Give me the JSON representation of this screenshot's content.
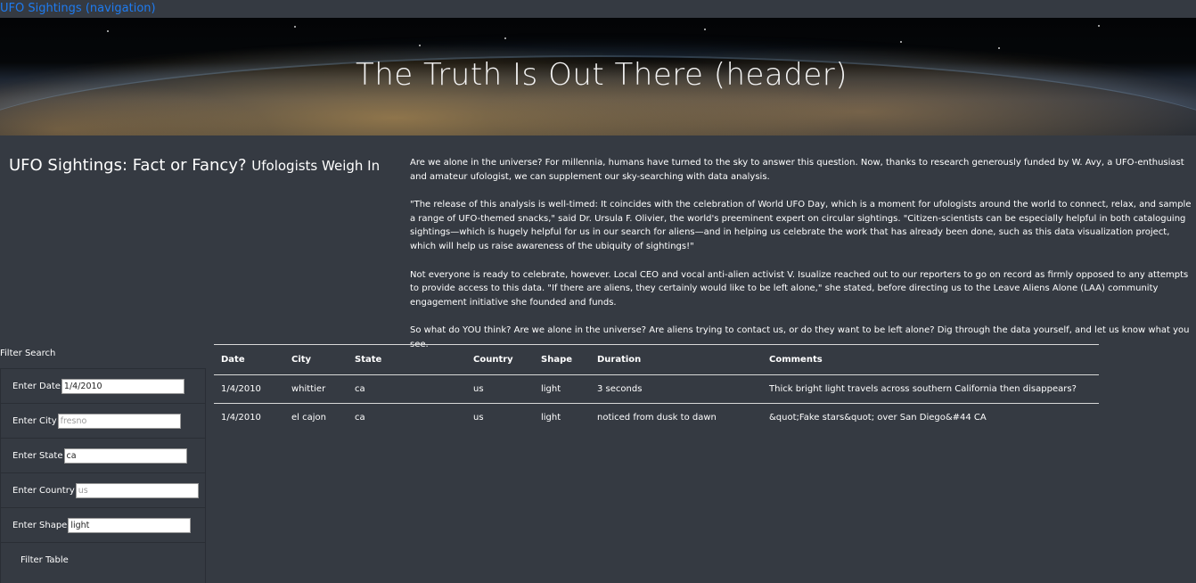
{
  "nav": {
    "brand": "UFO Sightings (navigation)"
  },
  "header": {
    "title": "The Truth Is Out There (header)"
  },
  "intro": {
    "heading": "UFO Sightings: Fact or Fancy?",
    "subheading": "Ufologists Weigh In",
    "paragraphs": [
      "Are we alone in the universe? For millennia, humans have turned to the sky to answer this question. Now, thanks to research generously funded by W. Avy, a UFO-enthusiast and amateur ufologist, we can supplement our sky-searching with data analysis.",
      "\"The release of this analysis is well-timed: It coincides with the celebration of World UFO Day, which is a moment for ufologists around the world to connect, relax, and sample a range of UFO-themed snacks,\" said Dr. Ursula F. Olivier, the world's preeminent expert on circular sightings. \"Citizen-scientists can be especially helpful in both cataloguing sightings—which is hugely helpful for us in our search for aliens—and in helping us celebrate the work that has already been done, such as this data visualization project, which will help us raise awareness of the ubiquity of sightings!\"",
      "Not everyone is ready to celebrate, however. Local CEO and vocal anti-alien activist V. Isualize reached out to our reporters to go on record as firmly opposed to any attempts to provide access to this data. \"If there are aliens, they certainly would like to be left alone,\" she stated, before directing us to the Leave Aliens Alone (LAA) community engagement initiative she founded and funds.",
      "So what do YOU think? Are we alone in the universe? Are aliens trying to contact us, or do they want to be left alone? Dig through the data yourself, and let us know what you see."
    ]
  },
  "filters": {
    "title": "Filter Search",
    "date": {
      "label": "Enter Date",
      "value": "1/4/2010",
      "placeholder": ""
    },
    "city": {
      "label": "Enter City",
      "value": "",
      "placeholder": "fresno"
    },
    "state": {
      "label": "Enter State",
      "value": "ca",
      "placeholder": ""
    },
    "country": {
      "label": "Enter Country",
      "value": "",
      "placeholder": "us"
    },
    "shape": {
      "label": "Enter Shape",
      "value": "light",
      "placeholder": ""
    },
    "button_label": "Filter Table"
  },
  "table": {
    "columns": [
      "Date",
      "City",
      "State",
      "Country",
      "Shape",
      "Duration",
      "Comments"
    ],
    "rows": [
      [
        "1/4/2010",
        "whittier",
        "ca",
        "us",
        "light",
        "3 seconds",
        "Thick bright light travels across southern California then disappears?"
      ],
      [
        "1/4/2010",
        "el cajon",
        "ca",
        "us",
        "light",
        "noticed from dusk to dawn",
        "&quot;Fake stars&quot; over San Diego&#44 CA"
      ]
    ]
  },
  "colors": {
    "background": "#353a42",
    "nav_link": "#1e7bf0",
    "text": "#ffffff"
  }
}
